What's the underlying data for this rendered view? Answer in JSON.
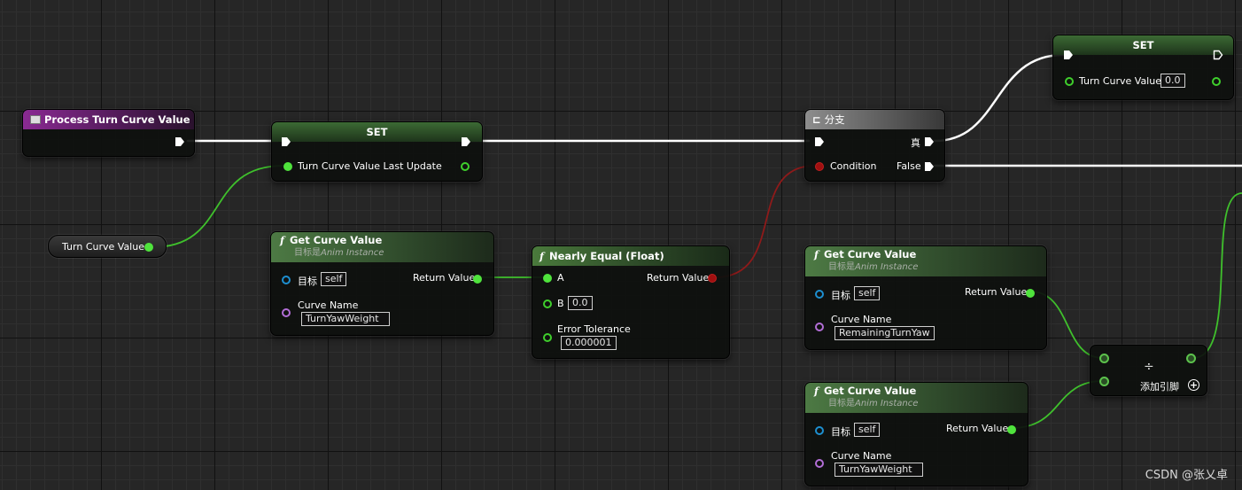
{
  "colors": {
    "exec": "#ffffff",
    "float": "#4fe33c",
    "bool": "#a01010",
    "object": "#1d8fd0",
    "name": "#b26ed6"
  },
  "event_node": {
    "title": "Process Turn Curve Value",
    "icon": "event-icon"
  },
  "set_node_1": {
    "title": "SET",
    "pin_label": "Turn Curve Value Last Update"
  },
  "turn_var_node": {
    "label": "Turn Curve Value"
  },
  "get_curve_1": {
    "title": "Get Curve Value",
    "target_prefix": "目标是",
    "target_class": "Anim Instance",
    "target_label": "目标",
    "target_value": "self",
    "return_label": "Return Value",
    "curve_name_label": "Curve Name",
    "curve_name_value": "TurnYawWeight"
  },
  "nearly_equal": {
    "title": "Nearly Equal (Float)",
    "a_label": "A",
    "b_label": "B",
    "b_value": "0.0",
    "return_label": "Return Value",
    "tolerance_label": "Error Tolerance",
    "tolerance_value": "0.000001"
  },
  "branch": {
    "title": "分支",
    "true_label": "真",
    "false_label": "False",
    "condition_label": "Condition"
  },
  "set_node_2": {
    "title": "SET",
    "pin_label": "Turn Curve Value",
    "pin_value": "0.0"
  },
  "get_curve_2": {
    "title": "Get Curve Value",
    "target_prefix": "目标是",
    "target_class": "Anim Instance",
    "target_label": "目标",
    "target_value": "self",
    "return_label": "Return Value",
    "curve_name_label": "Curve Name",
    "curve_name_value": "RemainingTurnYaw"
  },
  "get_curve_3": {
    "title": "Get Curve Value",
    "target_prefix": "目标是",
    "target_class": "Anim Instance",
    "target_label": "目标",
    "target_value": "self",
    "return_label": "Return Value",
    "curve_name_label": "Curve Name",
    "curve_name_value": "TurnYawWeight"
  },
  "divide_node": {
    "symbol": "÷",
    "add_pin_label": "添加引脚"
  },
  "watermark": "CSDN @张乂卓"
}
